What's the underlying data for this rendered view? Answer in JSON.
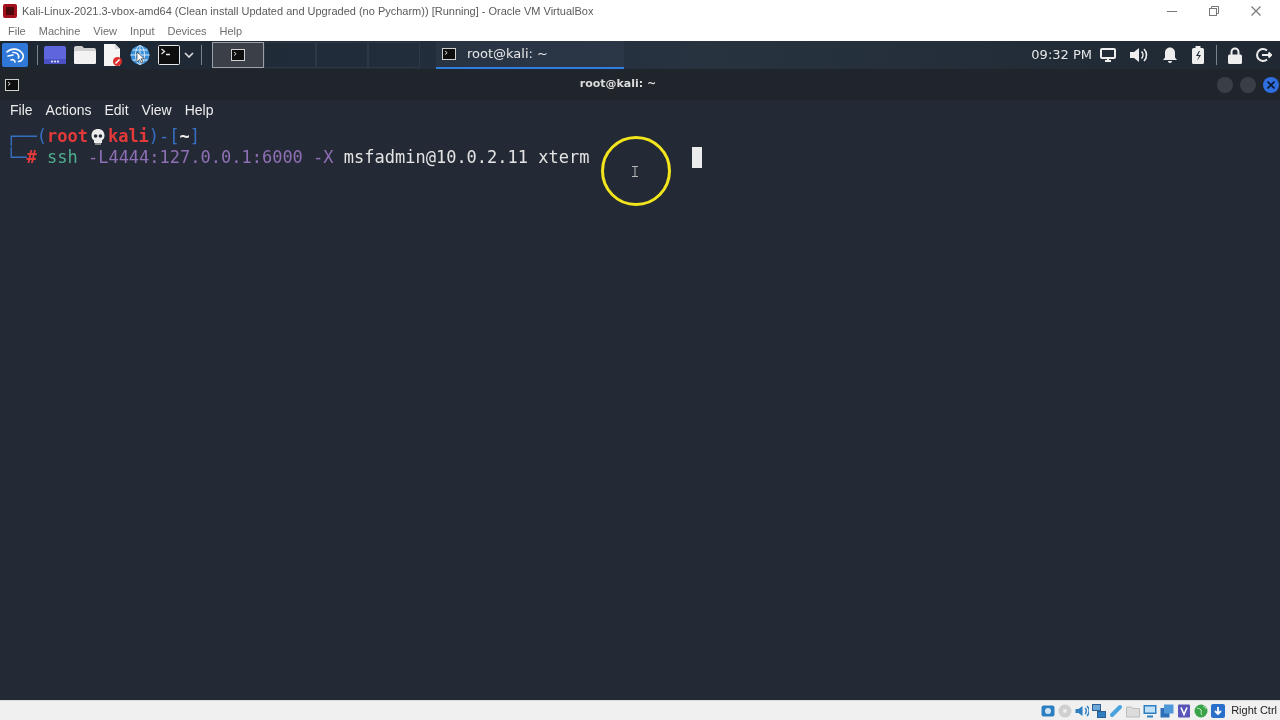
{
  "window": {
    "title": "Kali-Linux-2021.3-vbox-amd64 (Clean install Updated and Upgraded (no Pycharm)) [Running] - Oracle VM VirtualBox"
  },
  "menu_bar": [
    "File",
    "Machine",
    "View",
    "Input",
    "Devices",
    "Help"
  ],
  "panel": {
    "workspaces": [
      {
        "selected": true,
        "kind": "terminal"
      },
      {
        "selected": false,
        "kind": "empty"
      },
      {
        "selected": false,
        "kind": "empty"
      },
      {
        "selected": false,
        "kind": "empty"
      }
    ],
    "tasks": [
      {
        "label": "root@kali: ~",
        "selected": true
      }
    ],
    "clock": "09:32 PM"
  },
  "terminal": {
    "title": "root@kali: ~",
    "menu": [
      "File",
      "Actions",
      "Edit",
      "View",
      "Help"
    ],
    "prompt": {
      "frame_top": "┌──(",
      "user": "root",
      "host": "kali",
      "separator": ")-[",
      "directory": "~",
      "frame_end": "]",
      "frame_bottom": "└─",
      "symbol": "#"
    },
    "command": {
      "program": "ssh",
      "options": "-L4444:127.0.0.1:6000 -X",
      "arguments": "msfadmin@10.0.2.11 xterm"
    }
  },
  "status_bar": {
    "host_key": "Right Ctrl"
  }
}
